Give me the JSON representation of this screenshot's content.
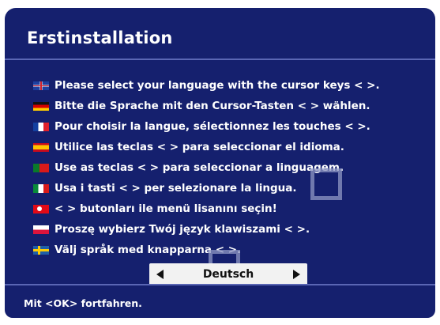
{
  "title": "Erstinstallation",
  "languages": [
    {
      "flag": "uk-flag-icon",
      "text": "Please select your language with the cursor keys <  >."
    },
    {
      "flag": "germany-flag-icon",
      "text": "Bitte die Sprache mit den Cursor-Tasten <  > wählen."
    },
    {
      "flag": "france-flag-icon",
      "text": "Pour choisir la langue, sélectionnez les touches <  >."
    },
    {
      "flag": "spain-flag-icon",
      "text": "Utilice las teclas <  > para seleccionar el idioma."
    },
    {
      "flag": "portugal-flag-icon",
      "text": "Use as teclas <  > para seleccionar a linguagem."
    },
    {
      "flag": "italy-flag-icon",
      "text": "Usa i tasti <  > per selezionare la lingua."
    },
    {
      "flag": "turkey-flag-icon",
      "text": "<  > butonları ile menü lisanını seçin!"
    },
    {
      "flag": "poland-flag-icon",
      "text": "Proszę wybierz Twój język klawiszami <  >."
    },
    {
      "flag": "sweden-flag-icon",
      "text": "Välj språk med knapparna <  >."
    }
  ],
  "selector": {
    "value": "Deutsch"
  },
  "footer": "Mit <OK> fortfahren.",
  "colors": {
    "background": "#15206e",
    "separator": "#5a66b4",
    "selector": "#f2f2f2"
  }
}
